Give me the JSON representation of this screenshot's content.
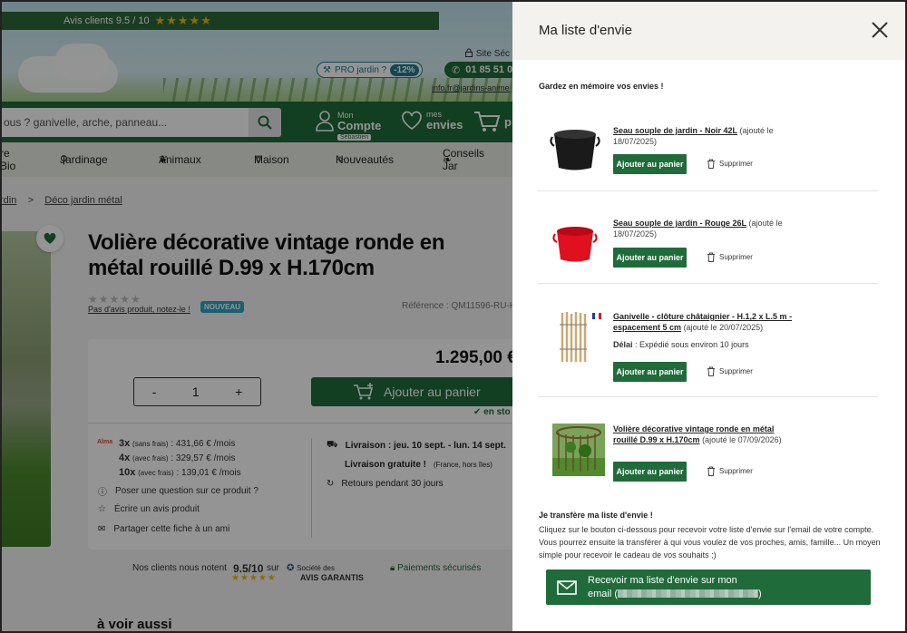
{
  "header": {
    "avis_label": "Avis clients 9.5 / 10",
    "avis_stars": "★★★★★",
    "site_secure": "Site Séc",
    "pro_label": "PRO jardin ?",
    "pro_pct": "-12%",
    "phone": "01 85 51 07",
    "email": "info.fr@jardins-anime",
    "search_placeholder": "ous ? ganivelle, arche, panneau...",
    "account_top": "Mon",
    "account_bottom": "Compte",
    "account_user": "Sébastien",
    "wishlist_top": "mes",
    "wishlist_bottom": "envies",
    "cart_label": "p"
  },
  "nav": [
    "re Bio",
    "Jardinage",
    "Animaux",
    "Maison",
    "Nouveautés",
    "Conseils Jar"
  ],
  "breadcrumb": {
    "item1": "rdin",
    "sep": ">",
    "item2": "Déco jardin métal"
  },
  "product": {
    "title": "Volière décorative vintage ronde en métal rouillé D.99 x H.170cm",
    "rating_stars": "★★★★★",
    "rating_text": "Pas d'avis produit, notez-le !",
    "badge": "NOUVEAU",
    "reference": "Référence : QM11596-RU-HT",
    "price": "1.295,00 €",
    "qty_minus": "-",
    "qty_value": "1",
    "qty_plus": "+",
    "add_to_cart": "Ajouter au panier",
    "stock": "✔ en sto",
    "alma": "Alma",
    "payments": [
      {
        "count": "3x",
        "note": "(sans frais)",
        "amount": ": 431,66 € /mois"
      },
      {
        "count": "4x",
        "note": "(avec frais)",
        "amount": ": 329,57 € /mois"
      },
      {
        "count": "10x",
        "note": "(avec frais)",
        "amount": ": 139,01 € /mois"
      }
    ],
    "question": "Poser une question sur ce produit ?",
    "review": "Écrire un avis produit",
    "share": "Partager cette fiche à un ami",
    "delivery": "Livraison : jeu. 10 sept. - lun. 14 sept.",
    "free_delivery": "Livraison gratuite !",
    "free_note": "(France, hors îles)",
    "returns": "Retours pendant 30 jours"
  },
  "trust": {
    "clients": "Nos clients nous notent",
    "score": "9.5/10",
    "sur": "sur",
    "stars": "★★★★★",
    "societe": "Société des",
    "garantis": "AVIS GARANTIS",
    "secure": "Paiements sécurisés"
  },
  "see_also": "à voir aussi",
  "wishlist": {
    "title": "Ma liste d'envie",
    "subtitle": "Gardez en mémoire vos envies !",
    "add_label": "Ajouter au panier",
    "delete_label": "Supprimer",
    "delai_label": "Délai",
    "items": [
      {
        "name": "Seau souple de jardin - Noir 42L",
        "date": "(ajouté le 18/07/2025)"
      },
      {
        "name": "Seau souple de jardin - Rouge 26L",
        "date": "(ajouté le 18/07/2025)"
      },
      {
        "name": "Ganivelle - clôture châtaignier - H.1,2 x L.5 m - espacement 5 cm",
        "date": "(ajouté le 20/07/2025)",
        "delai": ": Expédié sous environ 10 jours"
      },
      {
        "name": "Volière décorative vintage ronde en métal rouillé D.99 x H.170cm",
        "date": "(ajouté le 07/09/2026)"
      }
    ],
    "transfer_title": "Je transfère ma liste d'envie !",
    "transfer_text": "Cliquez sur le bouton ci-dessous pour recevoir votre liste d'envie sur l'email de votre compte. Vous pourrez ensuite la transférer à qui vous voulez de vos proches, amis, famille... Un moyen simple pour recevoir le cadeau de vos souhaits ;)",
    "send_line1": "Recevoir ma liste d'envie sur mon",
    "send_line2": "email (",
    "send_close": ")"
  },
  "colors": {
    "brand_green": "#1f6b3a",
    "overlay": "rgba(0,0,0,0.42)",
    "star_yellow": "#f2b70a",
    "badge_blue": "#2aa5c4"
  }
}
